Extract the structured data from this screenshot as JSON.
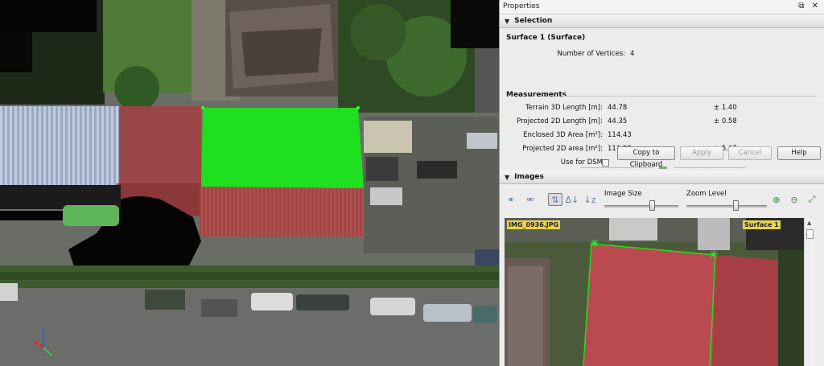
{
  "panel": {
    "title": "Properties",
    "window_controls": "ʂ ✕"
  },
  "selection": {
    "header": "Selection",
    "surface_title": "Surface 1 (Surface)",
    "vertices_label": "Number of Vertices:",
    "vertices_value": "4",
    "measurements_header": "Measurements",
    "rows": [
      {
        "label": "Terrain 3D Length [m]:",
        "value": "44.78",
        "error": "± 1.40"
      },
      {
        "label": "Projected 2D Length [m]:",
        "value": "44.35",
        "error": "± 0.58"
      },
      {
        "label": "Enclosed 3D Area [m²]:",
        "value": "114.43",
        "error": ""
      },
      {
        "label": "Projected 2D area [m²]:",
        "value": "111.29",
        "error": "± 5.67"
      }
    ],
    "dsm_label": "Use for DSM",
    "buttons": {
      "copy": "Copy to Clipboard",
      "apply": "Apply",
      "cancel": "Cancel",
      "help": "Help"
    }
  },
  "images": {
    "header": "Images",
    "image_size_label": "Image Size",
    "zoom_label": "Zoom Level",
    "image_size_level": 0.64,
    "zoom_level": 0.61,
    "image_name": "IMG_0936.JPG",
    "surface_tag": "Surface 1",
    "icons": [
      "link-icon",
      "unlink-icon",
      "sort-icon",
      "sort-delta-icon",
      "sort-alpha-icon",
      "zoom-in-icon",
      "zoom-out-icon",
      "fit-icon"
    ]
  },
  "colors": {
    "selection_green": "#1ee01e",
    "tag_yellow": "#e8d44d",
    "vertex_green": "#39ff39"
  }
}
